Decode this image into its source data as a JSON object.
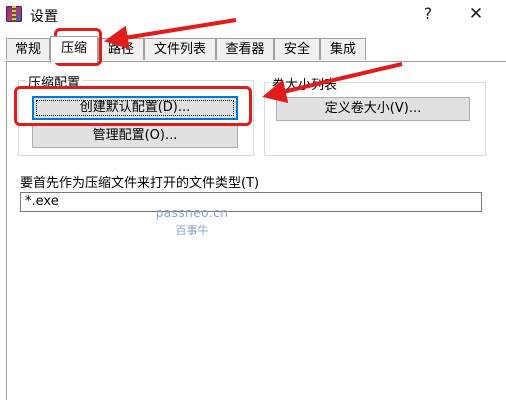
{
  "window": {
    "title": "设置",
    "help_glyph": "?",
    "close_glyph": "✕"
  },
  "tabs": [
    {
      "label": "常规",
      "active": false
    },
    {
      "label": "压缩",
      "active": true
    },
    {
      "label": "路径",
      "active": false
    },
    {
      "label": "文件列表",
      "active": false
    },
    {
      "label": "查看器",
      "active": false
    },
    {
      "label": "安全",
      "active": false
    },
    {
      "label": "集成",
      "active": false
    }
  ],
  "compression_profiles": {
    "group_label": "压缩配置",
    "create_default_button": "创建默认配置(D)...",
    "create_default_accel": "D",
    "manage_button": "管理配置(O)...",
    "manage_accel": "O"
  },
  "volume_sizes": {
    "group_label": "卷大小列表",
    "define_button": "定义卷大小(V)...",
    "define_accel": "V"
  },
  "archive_types": {
    "label": "要首先作为压缩文件来打开的文件类型(T)",
    "accel": "T",
    "value": "*.exe"
  },
  "watermark": {
    "domain": "passneo.cn",
    "brand": "百事牛"
  },
  "colors": {
    "annotation": "#e21b1b",
    "focus_blue": "#0078d7",
    "watermark": "#8aa3c8"
  }
}
